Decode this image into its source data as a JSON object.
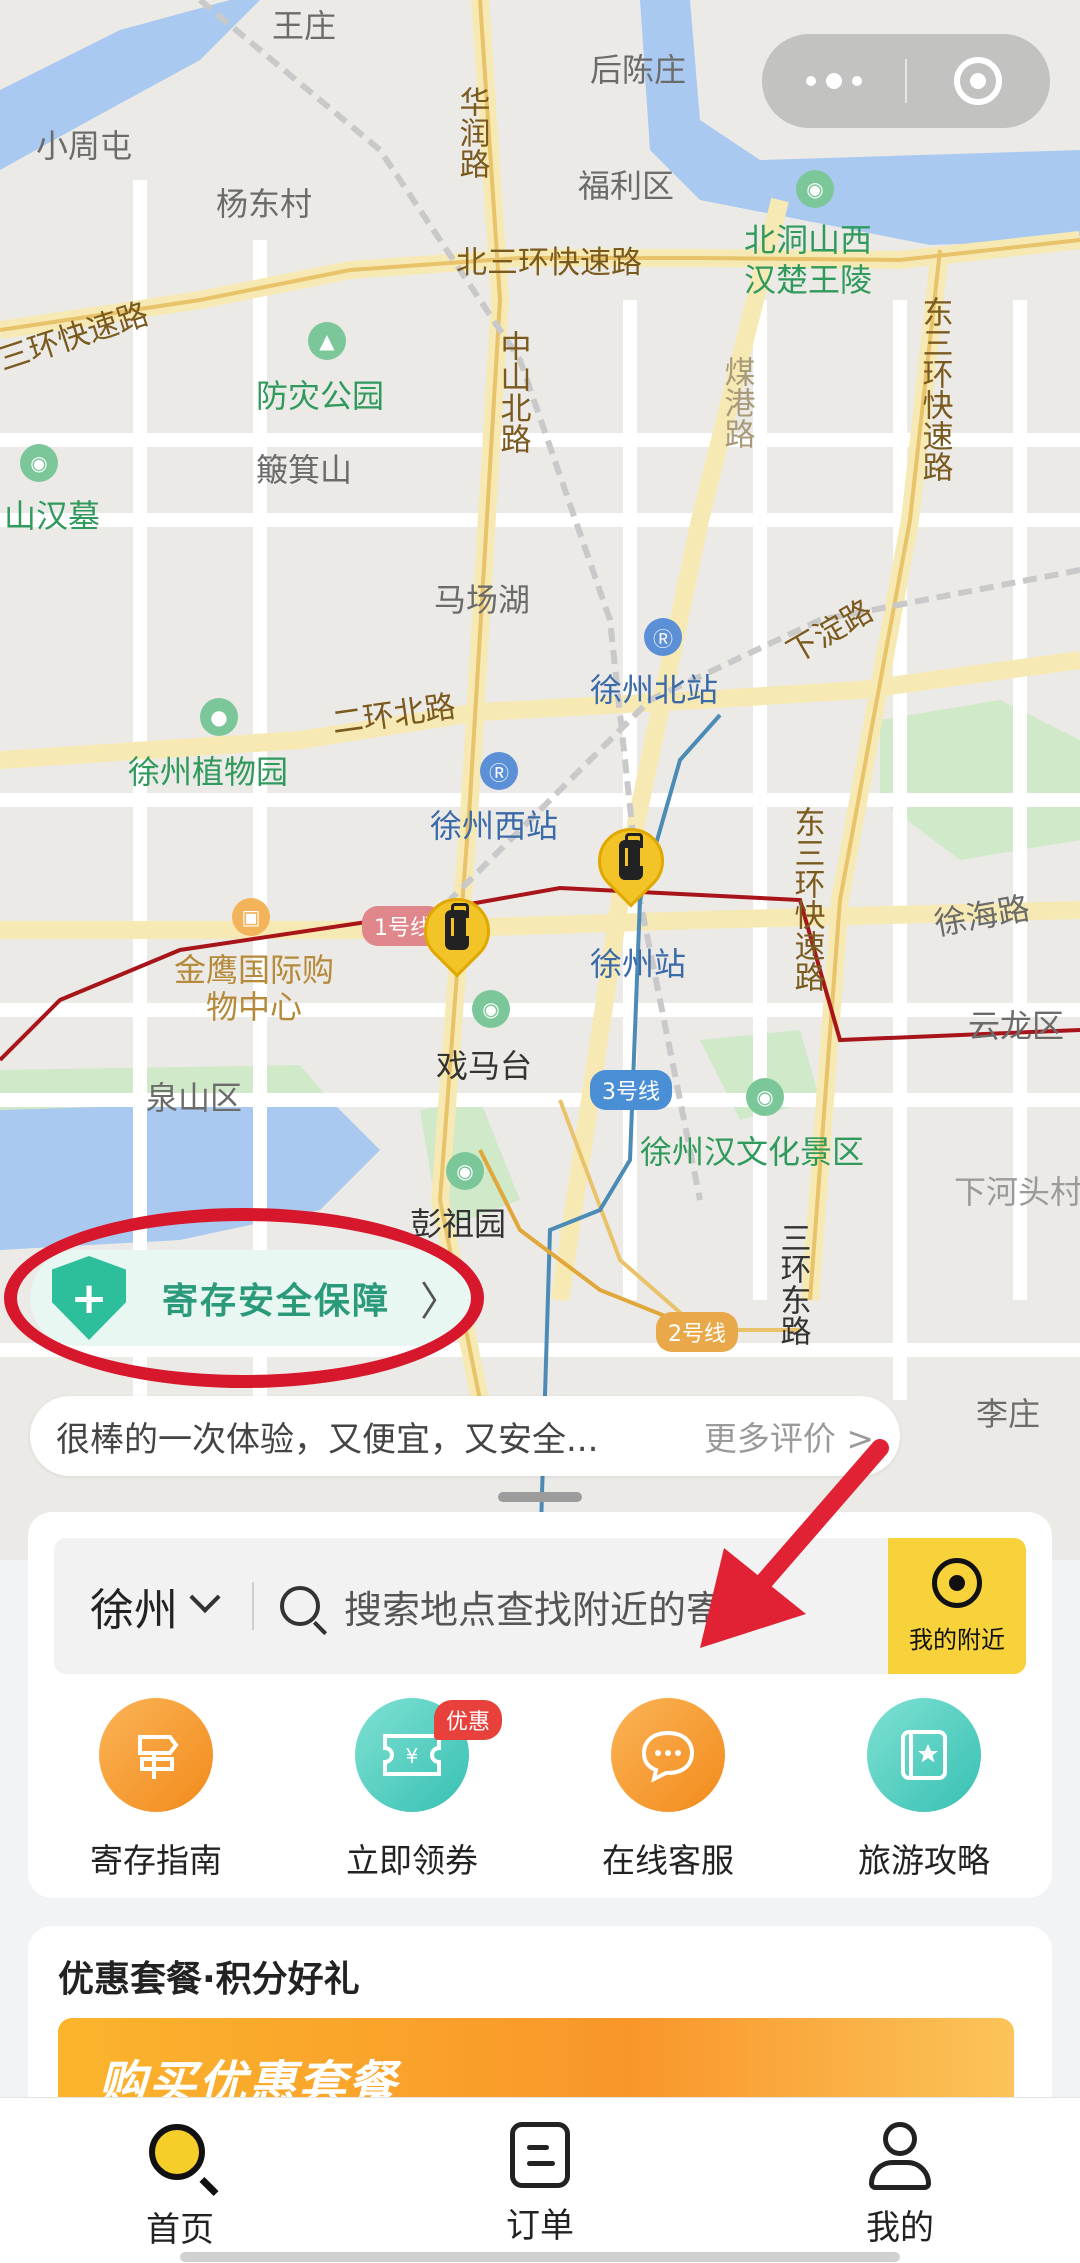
{
  "map": {
    "labels": {
      "wangzhuang": "王庄",
      "houchenzhuang": "后陈庄",
      "xiaozhoutun": "小周屯",
      "huarun_road": "华润路",
      "fulidistrict": "福利区",
      "yangdongcun": "杨东村",
      "beidongshanxi": "北洞山西",
      "hanchuwangling": "汉楚王陵",
      "beisanhuan": "北三环快速路",
      "huanexpress_left": "三环快速路",
      "dongsanhuan_top": "东三环快速路",
      "zhongshan_north": "中山北路",
      "mei_gang_road": "煤港路",
      "fangzai_park": "防灾公园",
      "bojishan": "簸箕山",
      "shanhanmu": "山汉墓",
      "machanghu": "马场湖",
      "xuzhou_north": "徐州北站",
      "xiadian_road": "下淀路",
      "erhuan_north": "二环北路",
      "botanical": "徐州植物园",
      "xuzhou_west": "徐州西站",
      "dongsanhuan_mid": "东三环快速路",
      "xuhai_road": "徐海路",
      "jinying": "金鹰国际购物中心",
      "xuzhou_station": "徐州站",
      "yunlong": "云龙区",
      "ximatai": "戏马台",
      "quanshan": "泉山区",
      "line3": "3号线",
      "hanculture": "徐州汉文化景区",
      "xiahetou": "下河头村",
      "pengzuyuan": "彭祖园",
      "sanhuan_east": "三环东路",
      "line2": "2号线",
      "lizhuang": "李庄",
      "line1": "1号线"
    }
  },
  "safety": {
    "label": "寄存安全保障"
  },
  "review": {
    "text": "很棒的一次体验，又便宜，又安全...",
    "more": "更多评价 >"
  },
  "search": {
    "city": "徐州",
    "placeholder": "搜索地点查找附近的寄存柜",
    "shown": "搜索地点查找附近的寄存",
    "nearby": "我的附近"
  },
  "shortcuts": [
    {
      "label": "寄存指南"
    },
    {
      "label": "立即领券",
      "badge": "优惠"
    },
    {
      "label": "在线客服"
    },
    {
      "label": "旅游攻略"
    }
  ],
  "promo": {
    "title": "优惠套餐·积分好礼",
    "banner": "购买优惠套餐"
  },
  "tabs": [
    {
      "label": "首页"
    },
    {
      "label": "订单"
    },
    {
      "label": "我的"
    }
  ],
  "colors": {
    "accent": "#F7D23B",
    "annotation": "#D7172B",
    "safety": "#2DBF9C"
  }
}
